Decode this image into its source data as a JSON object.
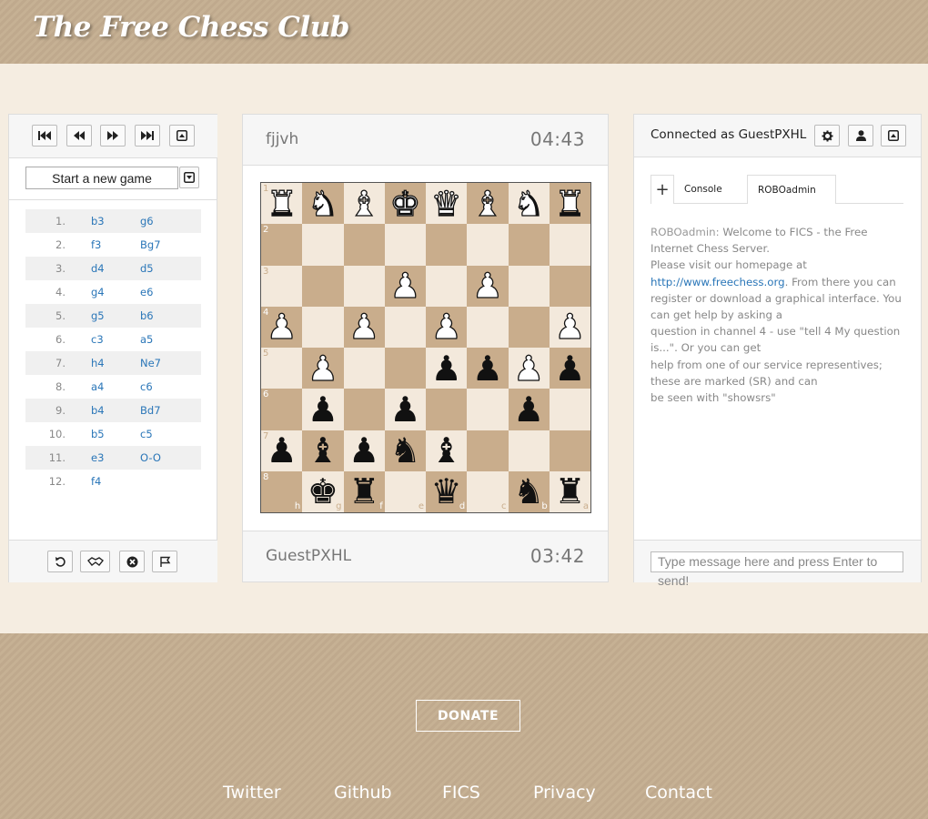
{
  "header": {
    "logo": "The Free Chess Club"
  },
  "left_panel": {
    "new_game_label": "Start a new game",
    "moves": [
      {
        "num": "1.",
        "white": "b3",
        "black": "g6"
      },
      {
        "num": "2.",
        "white": "f3",
        "black": "Bg7"
      },
      {
        "num": "3.",
        "white": "d4",
        "black": "d5"
      },
      {
        "num": "4.",
        "white": "g4",
        "black": "e6"
      },
      {
        "num": "5.",
        "white": "g5",
        "black": "b6"
      },
      {
        "num": "6.",
        "white": "c3",
        "black": "a5"
      },
      {
        "num": "7.",
        "white": "h4",
        "black": "Ne7"
      },
      {
        "num": "8.",
        "white": "a4",
        "black": "c6"
      },
      {
        "num": "9.",
        "white": "b4",
        "black": "Bd7"
      },
      {
        "num": "10.",
        "white": "b5",
        "black": "c5"
      },
      {
        "num": "11.",
        "white": "e3",
        "black": "O-O"
      },
      {
        "num": "12.",
        "white": "f4",
        "black": ""
      }
    ]
  },
  "game": {
    "top_player": "fjjvh",
    "top_clock": "04:43",
    "bottom_player": "GuestPXHL",
    "bottom_clock": "03:42",
    "rank_labels": [
      "1",
      "2",
      "3",
      "4",
      "5",
      "6",
      "7",
      "8"
    ],
    "file_labels": [
      "h",
      "g",
      "f",
      "e",
      "d",
      "c",
      "b",
      "a"
    ],
    "board": [
      [
        "wR",
        "wN",
        "wB",
        "wK",
        "wQ",
        "wB",
        "wN",
        "wR"
      ],
      [
        "",
        "",
        "",
        "",
        "",
        "",
        "",
        ""
      ],
      [
        "",
        "",
        "",
        "wP",
        "",
        "wP",
        "",
        ""
      ],
      [
        "wP",
        "",
        "wP",
        "",
        "wP",
        "",
        "",
        "wP"
      ],
      [
        "",
        "wP",
        "",
        "",
        "bP",
        "bP",
        "wP",
        "bP"
      ],
      [
        "",
        "bP",
        "",
        "bP",
        "",
        "",
        "bP",
        ""
      ],
      [
        "bP",
        "bB",
        "bP",
        "bN",
        "bB",
        "",
        "",
        ""
      ],
      [
        "",
        "bK",
        "bR",
        "",
        "bQ",
        "",
        "bN",
        "bR"
      ]
    ]
  },
  "right_panel": {
    "connected_label": "Connected as GuestPXHL",
    "tab_plus": "+",
    "tab_console": "Console",
    "tab_robo": "ROBOadmin",
    "chat_sender": "ROBOadmin:",
    "chat_line1": " Welcome to FICS - the Free Internet Chess Server.",
    "chat_line2": "Please visit our homepage at",
    "chat_link": "http://www.freechess.org",
    "chat_line3": ". From there you can register or download a graphical interface. You can get help by asking a",
    "chat_line4": "question in channel 4 - use \"tell 4 My question is...\". Or you can get",
    "chat_line5": "help from one of our service representives; these are marked (SR) and can",
    "chat_line6": "be seen with \"showsrs\"",
    "input_placeholder": "Type message here and press Enter to send!"
  },
  "footer": {
    "donate_label": "DONATE",
    "links": [
      "Twitter",
      "Github",
      "FICS",
      "Privacy",
      "Contact"
    ]
  },
  "colors": {
    "light_square": "#f3e9dc",
    "dark_square": "#c9ad8c",
    "link": "#2a76b8",
    "banner": "#c6b194"
  }
}
